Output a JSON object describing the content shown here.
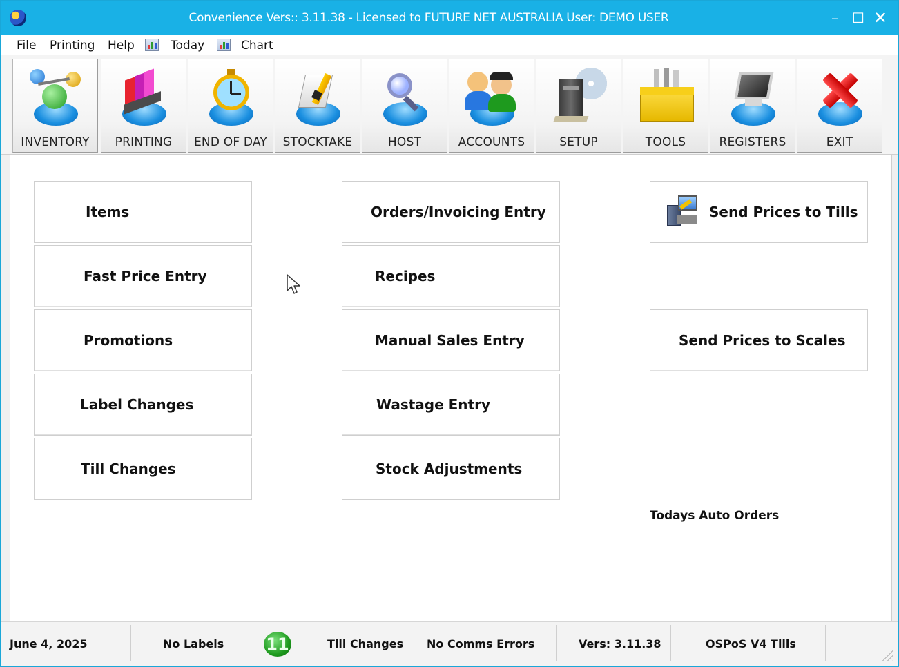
{
  "window": {
    "title": "Convenience Vers:: 3.11.38 - Licensed to FUTURE NET AUSTRALIA  User: DEMO USER"
  },
  "menu": {
    "items": [
      "File",
      "Printing",
      "Help",
      "Today",
      "Chart"
    ]
  },
  "toolbar": {
    "buttons": [
      {
        "label": "INVENTORY",
        "icon": "molecule-icon"
      },
      {
        "label": "PRINTING",
        "icon": "printer-colors-icon"
      },
      {
        "label": "END OF DAY",
        "icon": "clock-icon"
      },
      {
        "label": "STOCKTAKE",
        "icon": "notepad-pencil-icon"
      },
      {
        "label": "HOST",
        "icon": "magnifier-icon"
      },
      {
        "label": "ACCOUNTS",
        "icon": "users-group-icon"
      },
      {
        "label": "SETUP",
        "icon": "computer-cd-icon"
      },
      {
        "label": "TOOLS",
        "icon": "toolbox-icon"
      },
      {
        "label": "REGISTERS",
        "icon": "monitor-icon"
      },
      {
        "label": "EXIT",
        "icon": "red-x-icon"
      }
    ]
  },
  "main": {
    "left_buttons": [
      "Items",
      "Fast Price Entry",
      "Promotions",
      "Label Changes",
      "Till Changes"
    ],
    "middle_buttons": [
      "Orders/Invoicing Entry",
      "Recipes",
      "Manual Sales Entry",
      "Wastage Entry",
      "Stock Adjustments"
    ],
    "right_buttons": [
      "Send Prices to Tills",
      "Send Prices to Scales"
    ],
    "auto_orders_label": "Todays Auto Orders"
  },
  "status": {
    "date": "June 4, 2025",
    "labels": "No Labels",
    "till_changes_count": "11",
    "till_changes_label": "Till Changes",
    "comms": "No Comms Errors",
    "version": "Vers: 3.11.38",
    "tills": "OSPoS V4 Tills"
  },
  "colors": {
    "titlebar": "#19b1e6",
    "badge": "#1e9a1e"
  }
}
